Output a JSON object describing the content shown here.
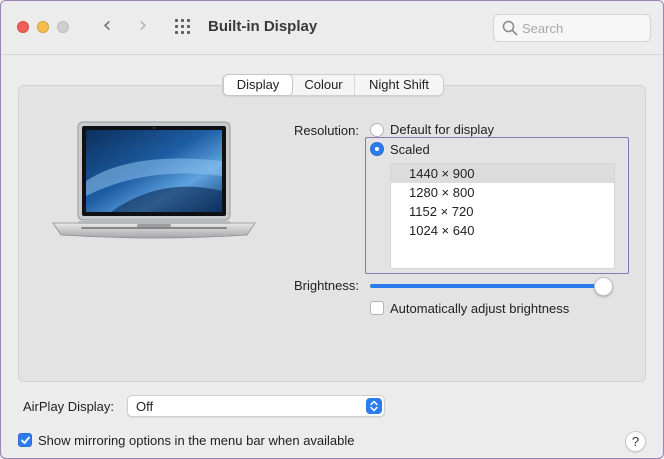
{
  "window": {
    "title": "Built-in Display"
  },
  "toolbar": {
    "back_glyph": "‹",
    "forward_glyph": "›"
  },
  "search": {
    "placeholder": "Search",
    "value": "",
    "icon": "search-icon"
  },
  "tabs": [
    {
      "label": "Display",
      "active": true
    },
    {
      "label": "Colour",
      "active": false
    },
    {
      "label": "Night Shift",
      "active": false
    }
  ],
  "resolution": {
    "label": "Resolution:",
    "options": [
      {
        "label": "Default for display",
        "selected": false
      },
      {
        "label": "Scaled",
        "selected": true
      }
    ],
    "scaled_list": [
      {
        "label": "1440 × 900",
        "selected": true
      },
      {
        "label": "1280 × 800",
        "selected": false
      },
      {
        "label": "1152 × 720",
        "selected": false
      },
      {
        "label": "1024 × 640",
        "selected": false
      }
    ]
  },
  "brightness": {
    "label": "Brightness:",
    "level": 0.99,
    "auto_label": "Automatically adjust brightness",
    "auto_checked": false
  },
  "airplay": {
    "label": "AirPlay Display:",
    "value": "Off"
  },
  "mirroring": {
    "label": "Show mirroring options in the menu bar when available",
    "checked": true
  },
  "help": {
    "label": "?"
  },
  "colors": {
    "accent": "#2c7cf0",
    "highlight_frame": "#8e74b5",
    "close": "#ee5f57",
    "minimize": "#f4bd4f"
  }
}
